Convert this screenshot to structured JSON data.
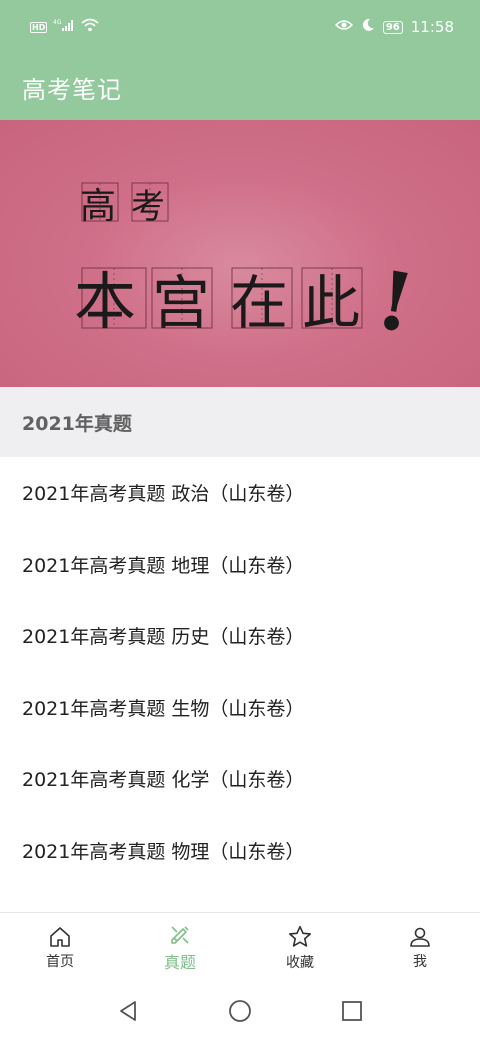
{
  "status_bar": {
    "hd": "HD",
    "network": "4G",
    "battery": "96",
    "time": "11:58"
  },
  "app_bar": {
    "title": "高考笔记"
  },
  "banner": {
    "line1": [
      "高",
      "考"
    ],
    "line2": [
      "本",
      "宫",
      "在",
      "此"
    ],
    "exclaim": "!"
  },
  "section": {
    "title": "2021年真题"
  },
  "list": {
    "items": [
      {
        "label": "2021年高考真题 政治（山东卷）"
      },
      {
        "label": "2021年高考真题 地理（山东卷）"
      },
      {
        "label": "2021年高考真题 历史（山东卷）"
      },
      {
        "label": "2021年高考真题 生物（山东卷）"
      },
      {
        "label": "2021年高考真题 化学（山东卷）"
      },
      {
        "label": "2021年高考真题 物理（山东卷）"
      }
    ]
  },
  "tabs": [
    {
      "label": "首页",
      "icon": "home-icon",
      "active": false
    },
    {
      "label": "真题",
      "icon": "exam-icon",
      "active": true
    },
    {
      "label": "收藏",
      "icon": "star-icon",
      "active": false
    },
    {
      "label": "我",
      "icon": "person-icon",
      "active": false
    }
  ],
  "colors": {
    "primary": "#93c99c",
    "active_tab": "#7fbf89",
    "banner": "#cf6f88"
  }
}
